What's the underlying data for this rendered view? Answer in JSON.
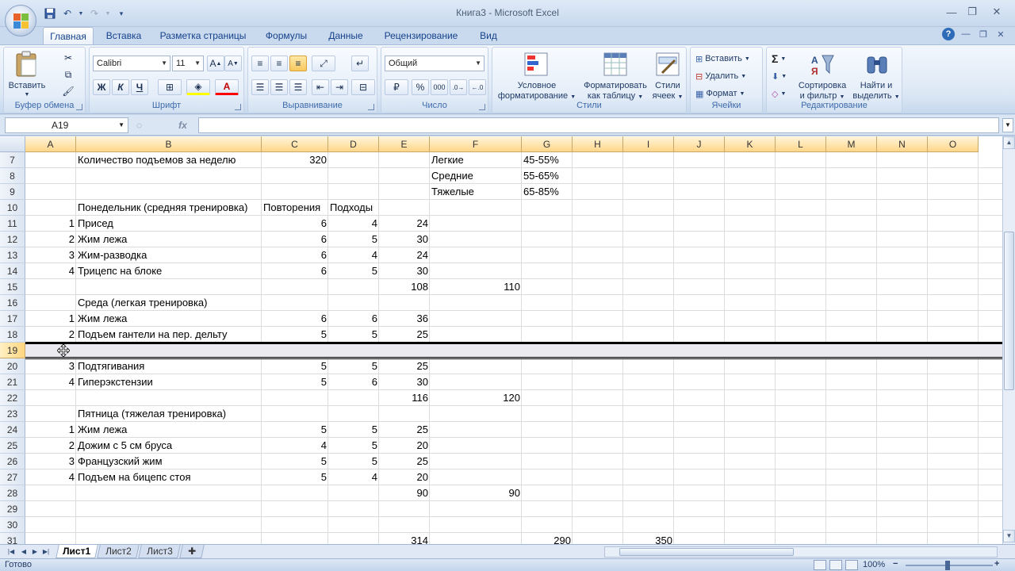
{
  "window": {
    "title": "Книга3 - Microsoft Excel"
  },
  "tabs": [
    "Главная",
    "Вставка",
    "Разметка страницы",
    "Формулы",
    "Данные",
    "Рецензирование",
    "Вид"
  ],
  "ribbon": {
    "clipboard": {
      "paste_label": "Вставить",
      "group_label": "Буфер обмена"
    },
    "font": {
      "font_name": "Calibri",
      "font_size": "11",
      "bold": "Ж",
      "italic": "К",
      "underline": "Ч",
      "group_label": "Шрифт"
    },
    "alignment": {
      "group_label": "Выравнивание"
    },
    "number": {
      "format": "Общий",
      "percent": "%",
      "thousands": "000",
      "group_label": "Число"
    },
    "styles": {
      "conditional_line1": "Условное",
      "conditional_line2": "форматирование",
      "as_table_line1": "Форматировать",
      "as_table_line2": "как таблицу",
      "cell_styles_line1": "Стили",
      "cell_styles_line2": "ячеек",
      "group_label": "Стили"
    },
    "cells": {
      "insert": "Вставить",
      "delete": "Удалить",
      "format": "Формат",
      "group_label": "Ячейки"
    },
    "editing": {
      "sigma": "Σ",
      "sort_line1": "Сортировка",
      "sort_line2": "и фильтр",
      "find_line1": "Найти и",
      "find_line2": "выделить",
      "group_label": "Редактирование"
    }
  },
  "formula_bar": {
    "name_box": "A19",
    "fx": "fx",
    "formula": ""
  },
  "columns": [
    "A",
    "B",
    "C",
    "D",
    "E",
    "F",
    "G",
    "H",
    "I",
    "J",
    "K",
    "L",
    "M",
    "N",
    "O"
  ],
  "rows": [
    {
      "num": "7",
      "cells": {
        "B": "Количество подъемов за неделю",
        "C": "320",
        "F": "Легкие",
        "G": "45-55%"
      }
    },
    {
      "num": "8",
      "cells": {
        "F": "Средние",
        "G": "55-65%"
      }
    },
    {
      "num": "9",
      "cells": {
        "F": "Тяжелые",
        "G": "65-85%"
      }
    },
    {
      "num": "10",
      "cells": {
        "B": "Понедельник (средняя тренировка)",
        "C": "Повторения",
        "D": "Подходы"
      }
    },
    {
      "num": "11",
      "cells": {
        "A": "1",
        "B": "Присед",
        "C": "6",
        "D": "4",
        "E": "24"
      }
    },
    {
      "num": "12",
      "cells": {
        "A": "2",
        "B": "Жим лежа",
        "C": "6",
        "D": "5",
        "E": "30"
      }
    },
    {
      "num": "13",
      "cells": {
        "A": "3",
        "B": "Жим-разводка",
        "C": "6",
        "D": "4",
        "E": "24"
      }
    },
    {
      "num": "14",
      "cells": {
        "A": "4",
        "B": "Трицепс на блоке",
        "C": "6",
        "D": "5",
        "E": "30"
      }
    },
    {
      "num": "15",
      "cells": {
        "E": "108",
        "F": "110"
      }
    },
    {
      "num": "16",
      "cells": {
        "B": "Среда (легкая тренировка)"
      }
    },
    {
      "num": "17",
      "cells": {
        "A": "1",
        "B": "Жим лежа",
        "C": "6",
        "D": "6",
        "E": "36"
      }
    },
    {
      "num": "18",
      "cells": {
        "A": "2",
        "B": "Подъем гантели на пер. дельту",
        "C": "5",
        "D": "5",
        "E": "25"
      }
    },
    {
      "num": "19",
      "cells": {}
    },
    {
      "num": "20",
      "cells": {
        "A": "3",
        "B": "Подтягивания",
        "C": "5",
        "D": "5",
        "E": "25"
      }
    },
    {
      "num": "21",
      "cells": {
        "A": "4",
        "B": "Гиперэкстензии",
        "C": "5",
        "D": "6",
        "E": "30"
      }
    },
    {
      "num": "22",
      "cells": {
        "E": "116",
        "F": "120"
      }
    },
    {
      "num": "23",
      "cells": {
        "B": "Пятница (тяжелая тренировка)"
      }
    },
    {
      "num": "24",
      "cells": {
        "A": "1",
        "B": "Жим лежа",
        "C": "5",
        "D": "5",
        "E": "25"
      }
    },
    {
      "num": "25",
      "cells": {
        "A": "2",
        "B": "Дожим с 5 см бруса",
        "C": "4",
        "D": "5",
        "E": "20"
      }
    },
    {
      "num": "26",
      "cells": {
        "A": "3",
        "B": "Французский жим",
        "C": "5",
        "D": "5",
        "E": "25"
      }
    },
    {
      "num": "27",
      "cells": {
        "A": "4",
        "B": "Подъем на бицепс стоя",
        "C": "5",
        "D": "4",
        "E": "20"
      }
    },
    {
      "num": "28",
      "cells": {
        "E": "90",
        "F": "90"
      }
    },
    {
      "num": "29",
      "cells": {}
    },
    {
      "num": "30",
      "cells": {}
    },
    {
      "num": "31",
      "cells": {
        "E": "314",
        "G": "290",
        "I": "350"
      }
    }
  ],
  "selected_row": "19",
  "sheets": [
    "Лист1",
    "Лист2",
    "Лист3"
  ],
  "active_sheet": "Лист1",
  "status": {
    "text": "Готово",
    "zoom": "100%",
    "zoom_minus": "−",
    "zoom_plus": "+"
  }
}
